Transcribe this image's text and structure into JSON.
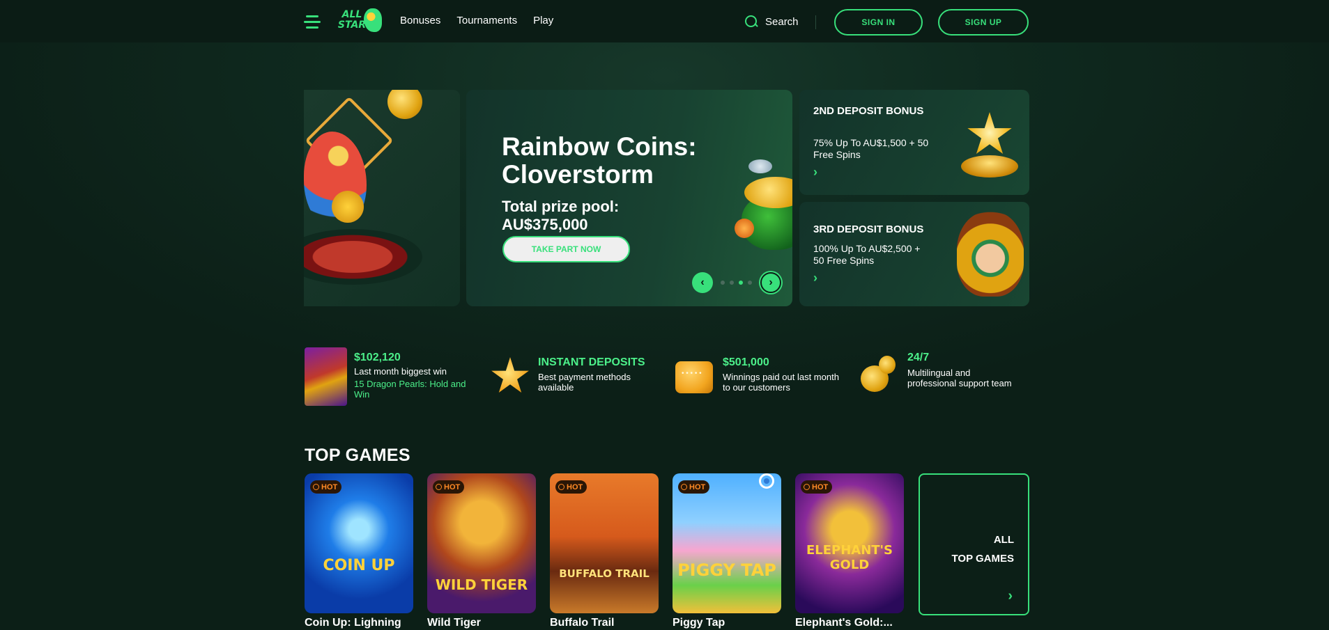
{
  "header": {
    "logo_text": "ALL STAR",
    "nav": [
      "Bonuses",
      "Tournaments",
      "Play"
    ],
    "search_label": "Search",
    "sign_in": "SIGN IN",
    "sign_up": "SIGN UP"
  },
  "hero": {
    "title": "Rainbow Coins: Cloverstorm",
    "prize_label": "Total prize pool:",
    "prize_value": "AU$375,000",
    "cta": "TAKE PART NOW",
    "prev_icon": "‹",
    "next_icon": "›",
    "dots_count": 4,
    "active_dot": 3
  },
  "promos": [
    {
      "title": "2ND DEPOSIT BONUS",
      "desc": "75% Up To AU$1,500 + 50 Free Spins",
      "arrow": "›"
    },
    {
      "title": "3RD DEPOSIT BONUS",
      "desc": "100% Up To AU$2,500 + 50 Free Spins",
      "arrow": "›"
    }
  ],
  "stats": [
    {
      "value": "$102,120",
      "text": "Last month biggest win",
      "sub": "15 Dragon Pearls: Hold and Win"
    },
    {
      "value": "INSTANT DEPOSITS",
      "text": "Best payment methods available"
    },
    {
      "value": "$501,000",
      "text": "Winnings paid out last month to our customers"
    },
    {
      "value": "24/7",
      "text": "Multilingual and professional support team"
    }
  ],
  "top_games": {
    "title": "TOP GAMES",
    "badge": "HOT",
    "games": [
      {
        "name": "Coin Up: Lighning",
        "logo": "COIN UP"
      },
      {
        "name": "Wild Tiger",
        "logo": "WILD TIGER"
      },
      {
        "name": "Buffalo Trail",
        "logo": "BUFFALO TRAIL"
      },
      {
        "name": "Piggy Tap",
        "logo": "PIGGY TAP"
      },
      {
        "name": "Elephant's Gold:...",
        "logo": "ELEPHANT'S GOLD"
      }
    ],
    "all_line1": "ALL",
    "all_line2": "TOP GAMES",
    "all_arrow": "›"
  },
  "colors": {
    "accent": "#38e07b",
    "background": "#0c1f17",
    "hot": "#ff8a25"
  }
}
